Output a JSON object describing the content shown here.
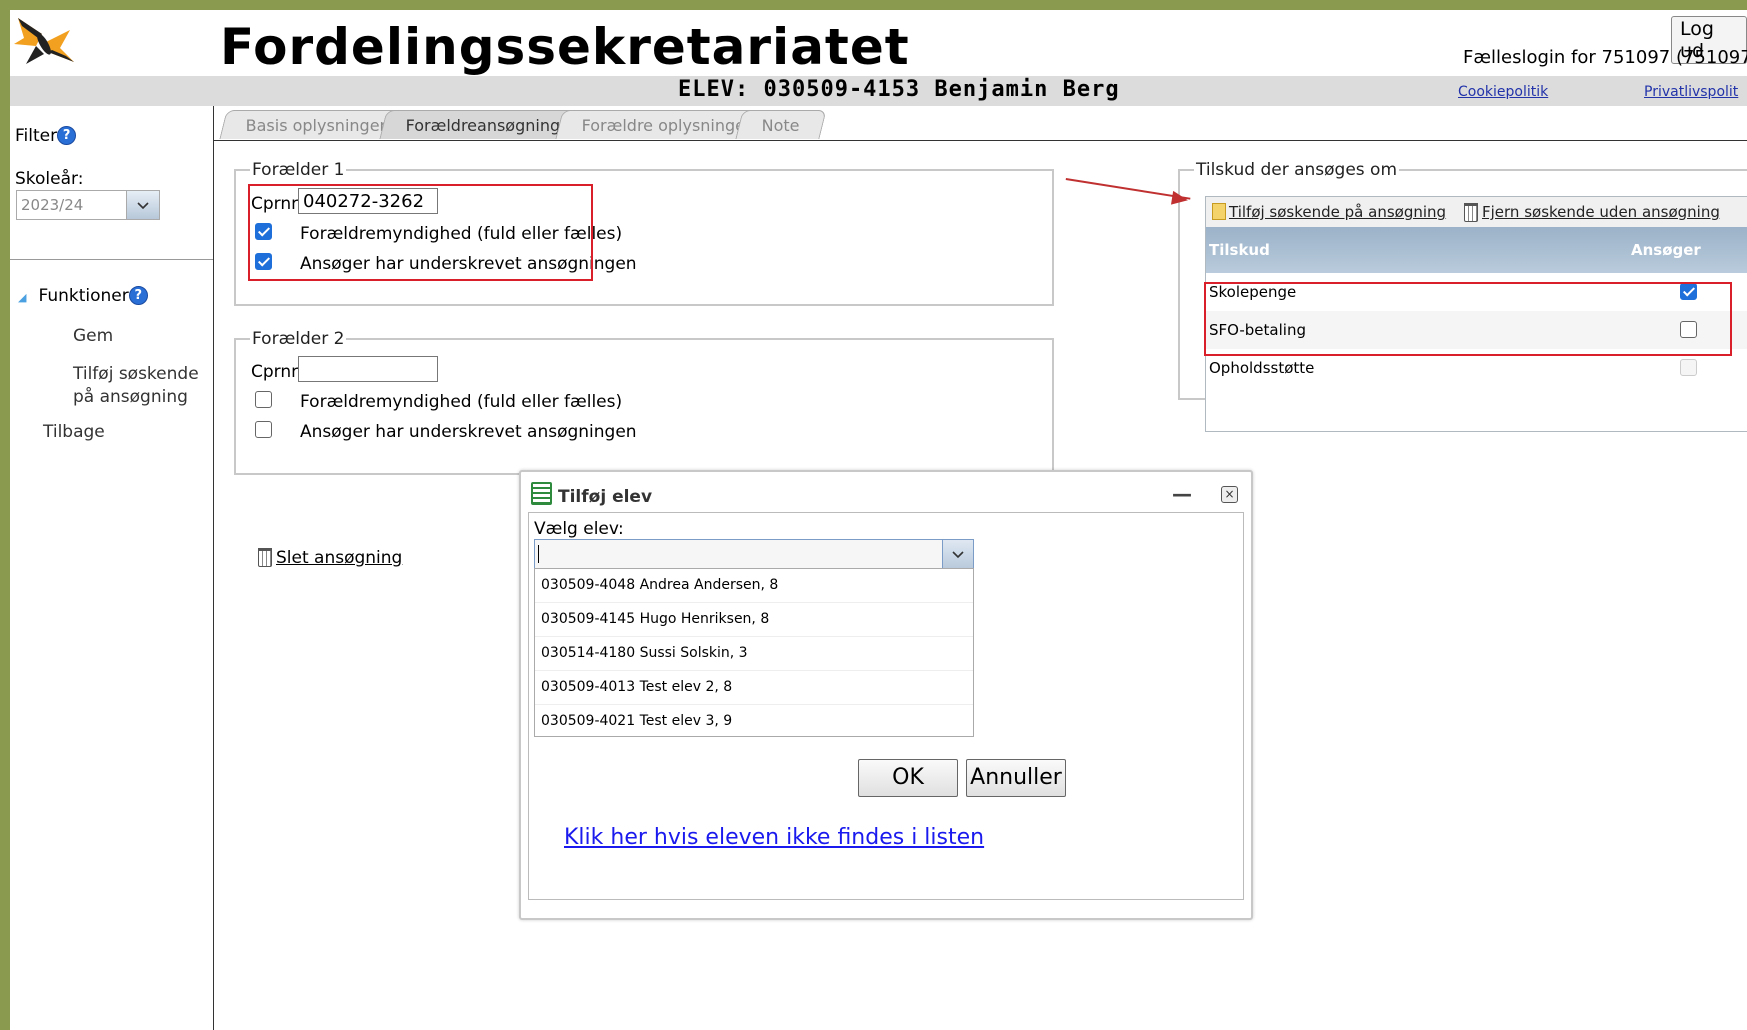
{
  "header": {
    "title": "Fordelingssekretariatet",
    "logout_label": "Log ud",
    "login_info": "Fælleslogin for 751097 (751097"
  },
  "student_bar": {
    "label": "ELEV: 030509-4153 Benjamin Berg",
    "cookie_link": "Cookiepolitik",
    "privacy_link": "Privatlivspolit"
  },
  "sidebar": {
    "filter_label": "Filter",
    "help": "?",
    "year_label": "Skoleår:",
    "year_value": "2023/24",
    "functions_label": "Funktioner",
    "items": [
      {
        "label": "Gem"
      },
      {
        "label": "Tilføj søskende"
      },
      {
        "label": "på ansøgning"
      },
      {
        "label": "Tilbage"
      }
    ]
  },
  "tabs": [
    {
      "label": "Basis oplysninger"
    },
    {
      "label": "Forældreansøgning"
    },
    {
      "label": "Forældre oplysninger"
    },
    {
      "label": "Note"
    }
  ],
  "parent1": {
    "legend": "Forælder 1",
    "cpr_label": "Cprnr:",
    "cpr_value": "040272-3262",
    "custody_label": "Forældremyndighed (fuld eller fælles)",
    "custody_checked": true,
    "signed_label": "Ansøger har underskrevet ansøgningen",
    "signed_checked": true
  },
  "parent2": {
    "legend": "Forælder 2",
    "cpr_label": "Cprnr:",
    "cpr_value": "",
    "custody_label": "Forældremyndighed (fuld eller fælles)",
    "custody_checked": false,
    "signed_label": "Ansøger har underskrevet ansøgningen",
    "signed_checked": false
  },
  "delete_label": "Slet ansøgning",
  "grants": {
    "legend": "Tilskud der ansøges om",
    "add_sibling": "Tilføj søskende på ansøgning",
    "remove_sibling": "Fjern søskende uden ansøgning",
    "col_grant": "Tilskud",
    "col_applicant": "Ansøger",
    "rows": [
      {
        "name": "Skolepenge",
        "checked": true
      },
      {
        "name": "SFO-betaling",
        "checked": false
      },
      {
        "name": "Opholdsstøtte",
        "checked": false,
        "disabled": true
      }
    ]
  },
  "dialog": {
    "title": "Tilføj elev",
    "minimize": "—",
    "close": "×",
    "select_label": "Vælg elev:",
    "input_value": "",
    "options": [
      "030509-4048 Andrea Andersen, 8",
      "030509-4145 Hugo Henriksen, 8",
      "030514-4180 Sussi Solskin, 3",
      "030509-4013 Test elev 2, 8",
      "030509-4021 Test elev 3, 9"
    ],
    "ok_label": "OK",
    "cancel_label": "Annuller",
    "not_found_link": "Klik her hvis eleven ikke findes i listen"
  },
  "colors": {
    "highlight_red": "#d9202a",
    "accent_blue": "#1e6fd9",
    "header_bar": "#dcdcdc"
  }
}
